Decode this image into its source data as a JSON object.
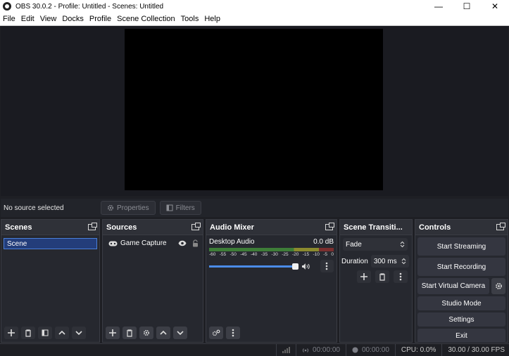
{
  "window": {
    "title": "OBS 30.0.2 - Profile: Untitled - Scenes: Untitled",
    "minimize_icon": "—",
    "maximize_icon": "☐",
    "close_icon": "✕"
  },
  "menu": [
    "File",
    "Edit",
    "View",
    "Docks",
    "Profile",
    "Scene Collection",
    "Tools",
    "Help"
  ],
  "context_bar": {
    "no_source": "No source selected",
    "properties_label": "Properties",
    "filters_label": "Filters"
  },
  "scenes": {
    "title": "Scenes",
    "items": [
      "Scene"
    ]
  },
  "sources": {
    "title": "Sources",
    "items": [
      {
        "name": "Game Capture",
        "visible": true,
        "locked": false
      }
    ]
  },
  "audio_mixer": {
    "title": "Audio Mixer",
    "channel_name": "Desktop Audio",
    "level": "0.0 dB",
    "scale": [
      "-60",
      "-55",
      "-50",
      "-45",
      "-40",
      "-35",
      "-30",
      "-25",
      "-20",
      "-15",
      "-10",
      "-5",
      "0"
    ],
    "volume_fraction": 1.0
  },
  "transitions": {
    "title": "Scene Transiti...",
    "selected": "Fade",
    "duration_label": "Duration",
    "duration_value": "300 ms"
  },
  "controls": {
    "title": "Controls",
    "start_streaming": "Start Streaming",
    "start_recording": "Start Recording",
    "start_virtual_camera": "Start Virtual Camera",
    "studio_mode": "Studio Mode",
    "settings": "Settings",
    "exit": "Exit"
  },
  "status": {
    "stream_time": "00:00:00",
    "record_time": "00:00:00",
    "cpu": "CPU: 0.0%",
    "fps": "30.00 / 30.00 FPS"
  },
  "colors": {
    "accent": "#4b8ce8",
    "panel": "#26282f",
    "selection": "#233d7a"
  }
}
